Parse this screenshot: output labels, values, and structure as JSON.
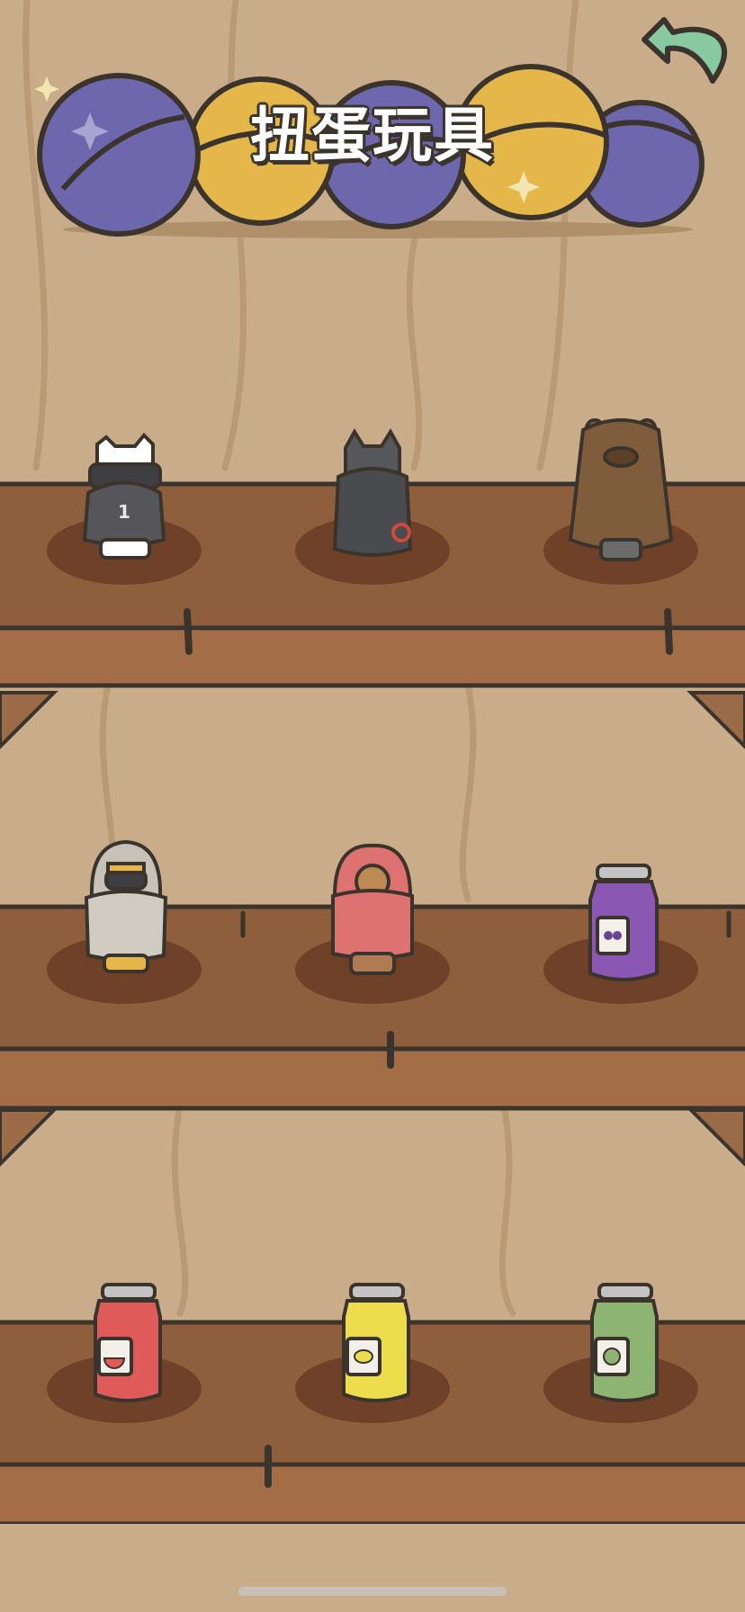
{
  "header": {
    "title": "扭蛋玩具",
    "back_icon": "back-arrow-icon"
  },
  "shelves": [
    {
      "row": 1,
      "items": [
        {
          "icon": "cat-ninja-figure-icon"
        },
        {
          "icon": "cat-cloak-figure-icon"
        },
        {
          "icon": "bear-figure-icon"
        }
      ]
    },
    {
      "row": 2,
      "items": [
        {
          "icon": "hooded-ninja-figure-icon"
        },
        {
          "icon": "red-hood-figure-icon"
        },
        {
          "icon": "grape-jam-jar-icon"
        }
      ]
    },
    {
      "row": 3,
      "items": [
        {
          "icon": "watermelon-jam-jar-icon"
        },
        {
          "icon": "lemon-jam-jar-icon"
        },
        {
          "icon": "melon-jam-jar-icon"
        }
      ]
    }
  ],
  "colors": {
    "wall": "#c9ac89",
    "shelf_top": "#8d5d3b",
    "shelf_front": "#a26d46",
    "outline": "#3a342c",
    "capsule_blue": "#6e67ad",
    "capsule_yellow": "#e5b74a",
    "back_green": "#89c9a2"
  }
}
